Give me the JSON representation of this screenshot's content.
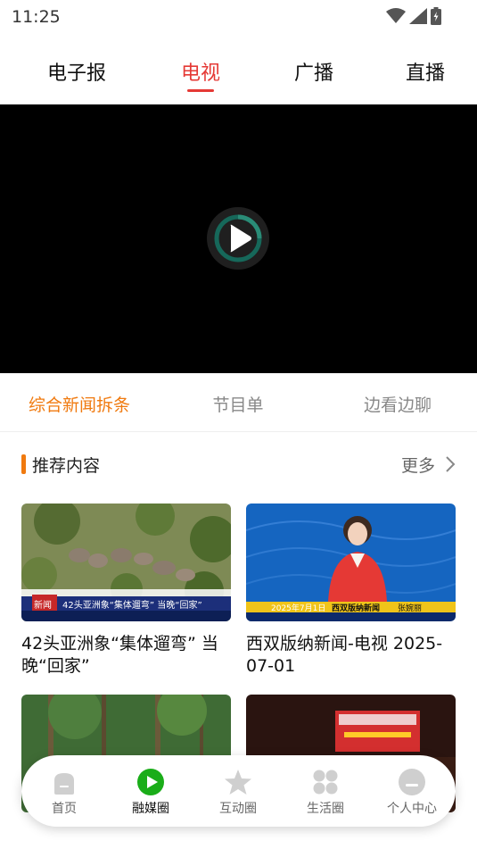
{
  "status_bar": {
    "time": "11:25"
  },
  "top_tabs": [
    {
      "label": "电子报",
      "active": false
    },
    {
      "label": "电视",
      "active": true
    },
    {
      "label": "广播",
      "active": false
    },
    {
      "label": "直播",
      "active": false
    }
  ],
  "sub_tabs": [
    {
      "label": "综合新闻拆条",
      "active": true
    },
    {
      "label": "节目单",
      "active": false
    },
    {
      "label": "边看边聊",
      "active": false
    }
  ],
  "section": {
    "title": "推荐内容",
    "more_label": "更多"
  },
  "cards": [
    {
      "title": "42头亚洲象“集体遛弯” 当晚“回家”",
      "thumb_caption": "42头亚洲象“集体遛弯” 当晚“回家”",
      "thumb_tag": "新闻"
    },
    {
      "title": "西双版纳新闻-电视 2025-07-01",
      "thumb_date": "2025年7月1日",
      "thumb_program": "西双版纳新闻",
      "thumb_name": "张婉丽"
    },
    {
      "title": ""
    },
    {
      "title": ""
    }
  ],
  "bottom_nav": [
    {
      "label": "首页",
      "icon": "home-icon",
      "active": false
    },
    {
      "label": "融媒圈",
      "icon": "play-circle-icon",
      "active": true
    },
    {
      "label": "互动圈",
      "icon": "star-icon",
      "active": false
    },
    {
      "label": "生活圈",
      "icon": "grid-icon",
      "active": false
    },
    {
      "label": "个人中心",
      "icon": "profile-icon",
      "active": false
    }
  ],
  "colors": {
    "accent_red": "#e53935",
    "accent_orange": "#f07a0f",
    "nav_active_green": "#1aad19"
  }
}
